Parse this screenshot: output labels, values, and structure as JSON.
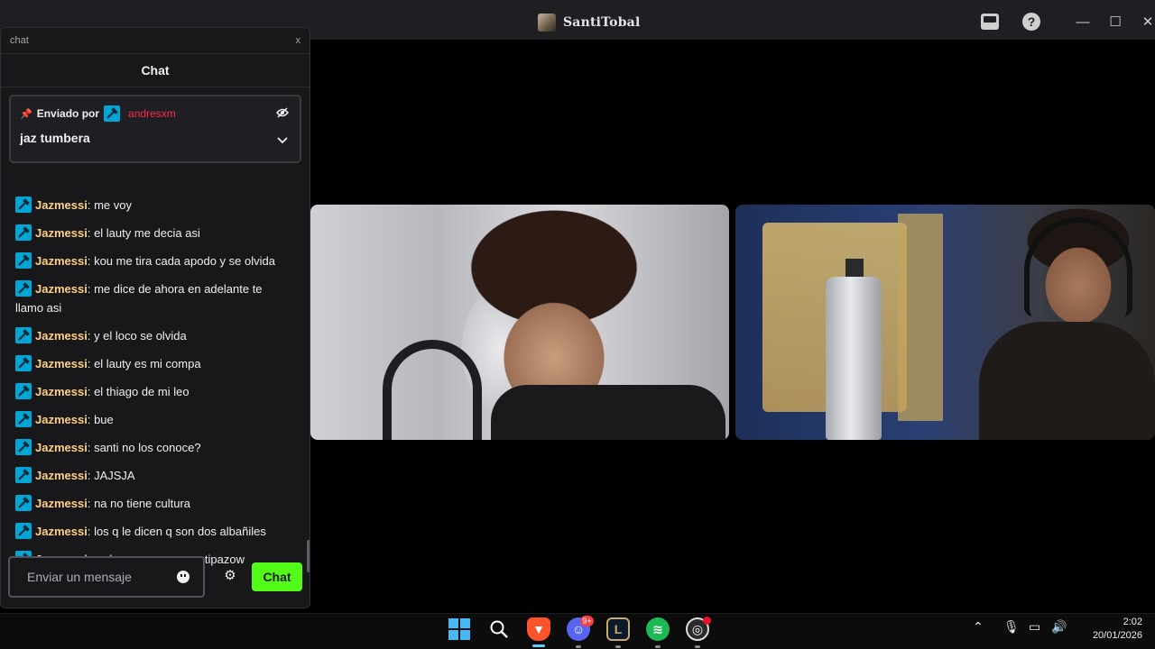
{
  "window": {
    "title": "SantiTobal",
    "buttons": {
      "minimize": "—",
      "maximize": "☐",
      "close": "✕",
      "help": "?"
    }
  },
  "chat_panel": {
    "header_title": "chat",
    "header_close": "x",
    "heading": "Chat",
    "pinned": {
      "sent_by_label": "Enviado por",
      "user": "andresxm",
      "message": "jaz tumbera"
    },
    "messages": [
      {
        "user": "Jazmessi",
        "text": "me voy"
      },
      {
        "user": "Jazmessi",
        "text": "el lauty me decia asi"
      },
      {
        "user": "Jazmessi",
        "text": "kou me tira cada apodo y se olvida"
      },
      {
        "user": "Jazmessi",
        "text": "me dice de ahora en adelante te llamo asi"
      },
      {
        "user": "Jazmessi",
        "text": "y el loco se olvida"
      },
      {
        "user": "Jazmessi",
        "text": "el lauty es mi compa"
      },
      {
        "user": "Jazmessi",
        "text": "el thiago de mi leo"
      },
      {
        "user": "Jazmessi",
        "text": "bue"
      },
      {
        "user": "Jazmessi",
        "text": "santi no los conoce?"
      },
      {
        "user": "Jazmessi",
        "text": "JAJSJA"
      },
      {
        "user": "Jazmessi",
        "text": "na no tiene cultura"
      },
      {
        "user": "Jazmessi",
        "text": "los q le dicen q son dos albañiles"
      },
      {
        "user": "Jazmessi",
        "text": "yo los amo son unos tipazow"
      }
    ],
    "input_placeholder": "Enviar un mensaje",
    "send_label": "Chat",
    "colors": {
      "accent": "#53fc18",
      "username": "#ffcf86",
      "pinned_user": "#ff2b4a",
      "badge": "#00a6d6"
    }
  },
  "taskbar": {
    "discord_badge": "9+",
    "time": "2:02",
    "date": "20/01/2026",
    "apps": [
      "start-icon",
      "search-icon",
      "brave-icon",
      "discord-icon",
      "league-of-legends-icon",
      "spotify-icon",
      "obs-icon"
    ]
  }
}
